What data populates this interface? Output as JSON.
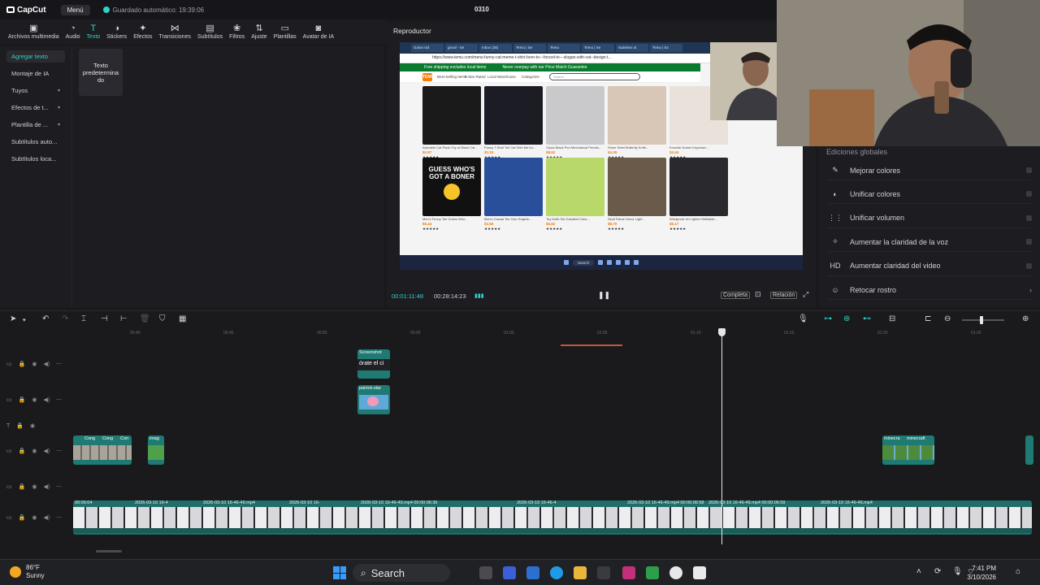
{
  "app": {
    "brand": "CapCut",
    "menu_label": "Menú",
    "autosave": "Guardado automático: 19:39:06",
    "project_name": "0310"
  },
  "toolbar": [
    {
      "icon": "media-icon",
      "glyph": "▣",
      "label": "Archivos multimedia"
    },
    {
      "icon": "audio-icon",
      "glyph": "◔",
      "label": "Audio"
    },
    {
      "icon": "text-icon",
      "glyph": "T",
      "label": "Texto",
      "active": true
    },
    {
      "icon": "stickers-icon",
      "glyph": "◑",
      "label": "Stickers"
    },
    {
      "icon": "effects-icon",
      "glyph": "✦",
      "label": "Efectos"
    },
    {
      "icon": "transitions-icon",
      "glyph": "⋈",
      "label": "Transiciones"
    },
    {
      "icon": "subtitles-icon",
      "glyph": "▤",
      "label": "Subtítulos"
    },
    {
      "icon": "filters-icon",
      "glyph": "❀",
      "label": "Filtros"
    },
    {
      "icon": "adjust-icon",
      "glyph": "⇅",
      "label": "Ajuste"
    },
    {
      "icon": "templates-icon",
      "glyph": "▭",
      "label": "Plantillas"
    },
    {
      "icon": "avatar-icon",
      "glyph": "◙",
      "label": "Avatar de IA"
    }
  ],
  "left_nav": [
    {
      "label": "Agregar texto",
      "active": true,
      "chevron": false
    },
    {
      "label": "Montaje de IA",
      "active": false,
      "chevron": false
    },
    {
      "label": "Tuyos",
      "active": false,
      "chevron": true
    },
    {
      "label": "Efectos de t...",
      "active": false,
      "chevron": true
    },
    {
      "label": "Plantilla de ...",
      "active": false,
      "chevron": true
    },
    {
      "label": "Subtítulos auto...",
      "active": false,
      "chevron": false
    },
    {
      "label": "Subtítulos loca...",
      "active": false,
      "chevron": false
    }
  ],
  "text_card": "Texto predetermina do",
  "player": {
    "title": "Reproductor",
    "current_time": "00:01:11:48",
    "total_time": "00:28:14:23",
    "btn_full": "Completa",
    "btn_ratio": "Relación"
  },
  "browser": {
    "tabs": [
      "Golon vid",
      "gmail - Se",
      "Inbox (36)",
      "Temu | Se",
      "Temu",
      "Temu | Se",
      "stainless st",
      "Temu | Ex"
    ],
    "url": "https://www.temu.com/mens-funny-cat-meme-t-shirt-born-to---forced-to---slogan-with-cat--design-t...",
    "promo1": "Free shipping excludes local items",
    "promo2": "Never overpay with our Price Match Guarantee",
    "temu_logo": "TEMU",
    "nav_items": [
      "Best-Selling Items",
      "5-Star Rated",
      "Local Warehouse",
      "Categories"
    ],
    "search_placeholder": "Search",
    "products": [
      {
        "title": "Adorable Cat Plush Toy of Black Cat...",
        "price": "$2.97",
        "rating": "★★★★★"
      },
      {
        "title": "Funny T-Shirt Tell Cat Shirt Me for...",
        "price": "$3.18",
        "rating": "★★★★★"
      },
      {
        "title": "10pcs Black Pen Mechanical Pencils...",
        "price": "$8.62",
        "rating": "★★★★★"
      },
      {
        "title": "Sheer Steel Butterfly Knife...",
        "price": "$4.26",
        "rating": "★★★★★"
      },
      {
        "title": "Knuckle Duster Keychain...",
        "price": "$3.44",
        "rating": "★★★★★"
      },
      {
        "title": "Men's Funny Tee Guess Who...",
        "price": "$5.44",
        "rating": "★★★★★"
      },
      {
        "title": "Men's Casual Tee Gun Graphic...",
        "price": "$3.55",
        "rating": "★★★★★"
      },
      {
        "title": "Toy Knife Set Gradient Color...",
        "price": "$5.82",
        "rating": "★★★★★"
      },
      {
        "title": "Skull Flame Decor Light...",
        "price": "$8.70",
        "rating": "★★★★★"
      },
      {
        "title": "Windproof Jet Lighter Refillable...",
        "price": "$6.17",
        "rating": "★★★★★"
      }
    ],
    "product_texts": [
      "GUESS WHO'S GOT A BONER"
    ],
    "taskbar_search": "Search"
  },
  "global_edits": {
    "title": "Ediciones globales",
    "items": [
      {
        "icon": "enhance-colors-icon",
        "glyph": "✎",
        "label": "Mejorar colores",
        "arrow": false
      },
      {
        "icon": "unify-colors-icon",
        "glyph": "◐",
        "label": "Unificar colores",
        "arrow": false
      },
      {
        "icon": "unify-volume-icon",
        "glyph": "⋮⋮",
        "label": "Unificar volumen",
        "arrow": false
      },
      {
        "icon": "voice-clarity-icon",
        "glyph": "✧",
        "label": "Aumentar la claridad de la voz",
        "arrow": false
      },
      {
        "icon": "hd-icon",
        "glyph": "HD",
        "label": "Aumentar claridad del video",
        "arrow": false
      },
      {
        "icon": "retouch-icon",
        "glyph": "☺",
        "label": "Retocar rostro",
        "arrow": true
      }
    ]
  },
  "timeline": {
    "ruler": [
      "00:40",
      "00:45",
      "00:50",
      "00:55",
      "01:00",
      "01:05",
      "01:10",
      "01:15",
      "01:20",
      "01:25"
    ],
    "clips": {
      "screenshot": "Screenshot",
      "text_snippet": "órate el ci",
      "patrick": "patrick-star",
      "cong1": "Cong",
      "cong2": "Cong",
      "cong3": "Con",
      "image": "imag",
      "mine1": "minecra",
      "mine2": "minecraft",
      "main": [
        "00:05:04",
        "2026-03-10 16-4",
        "2026-03-10 16-46-49.mp4",
        "2026-03-10 16-",
        "2026-03-10 16-46-49.mp4 00:00:06:36",
        "2026-03-10 16-46-4",
        "2026-03-10 16-46-49.mp4 00:00:06:58",
        "2026-03-10 16-46-49.mp4 00:00:06:59",
        "2026-03-10 16-46-49.mp4"
      ]
    }
  },
  "taskbar": {
    "temp": "86°F",
    "weather": "Sunny",
    "search": "Search",
    "time": "7:41 PM",
    "date": "3/10/2026"
  }
}
